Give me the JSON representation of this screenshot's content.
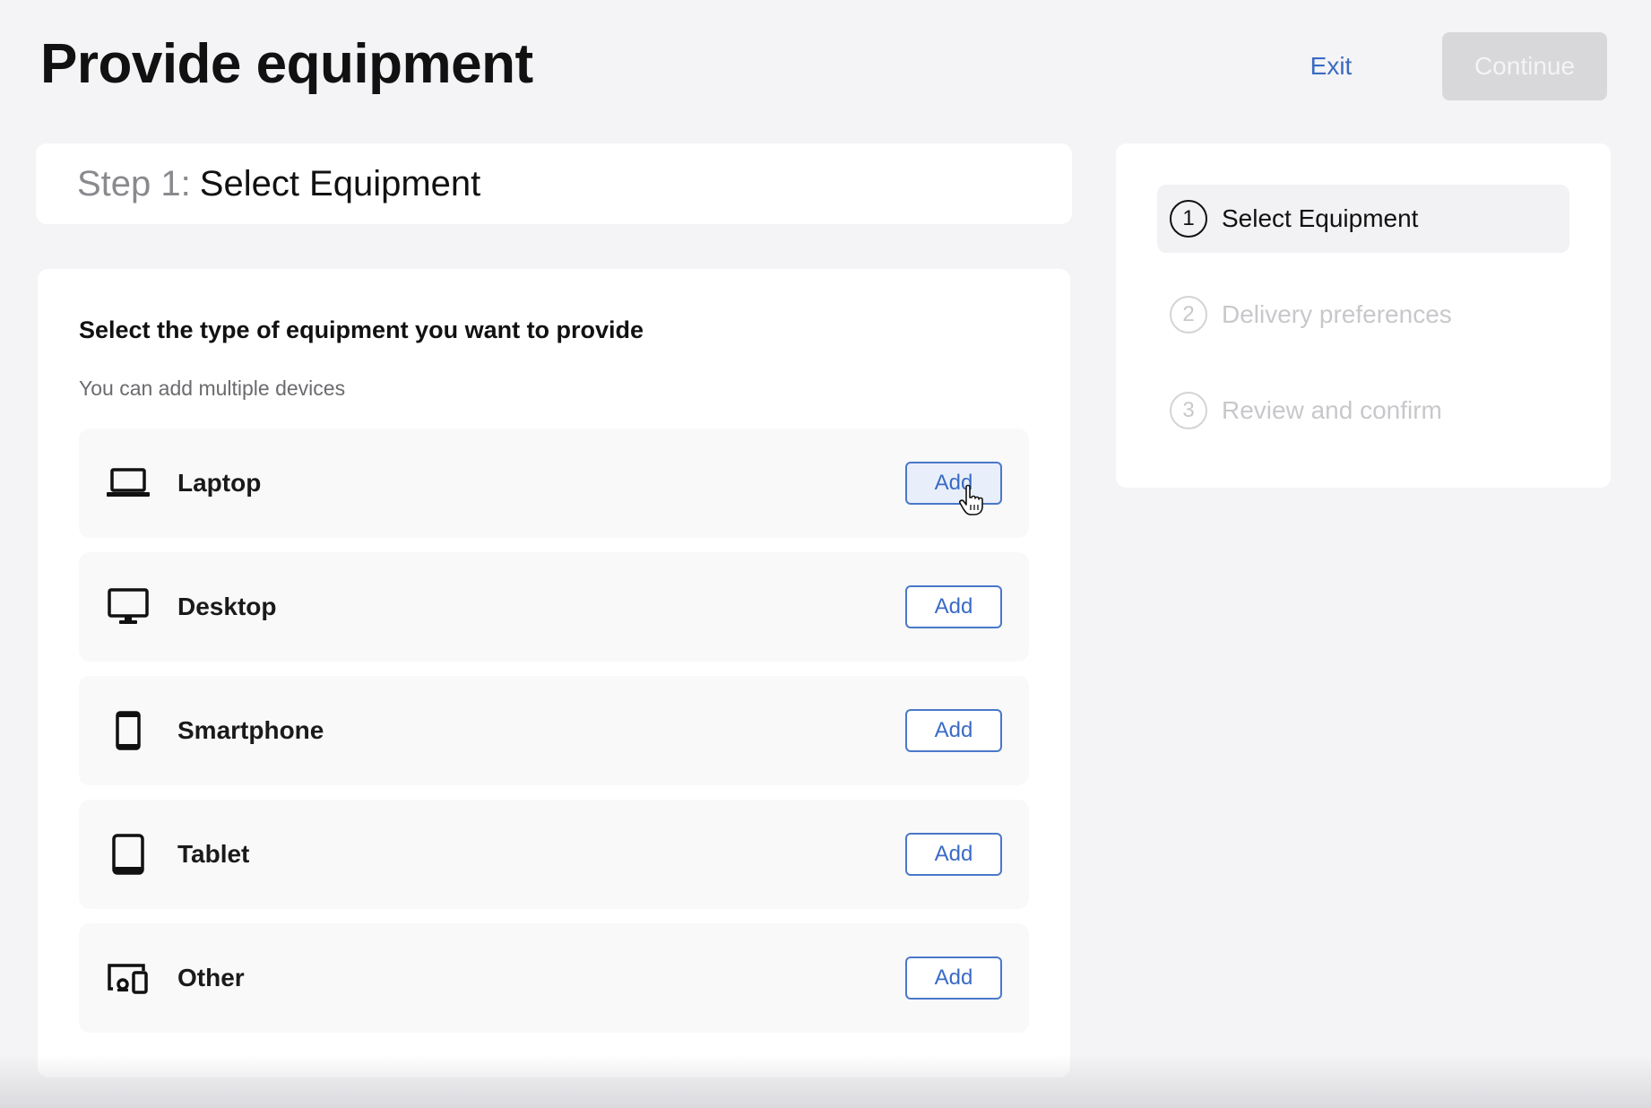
{
  "header": {
    "title": "Provide equipment",
    "exit_label": "Exit",
    "continue_label": "Continue"
  },
  "step_header": {
    "prefix": "Step 1:",
    "name": "Select Equipment"
  },
  "equipment": {
    "title": "Select the type of equipment you want to provide",
    "subtitle": "You can add multiple devices",
    "add_label": "Add",
    "devices": [
      {
        "label": "Laptop",
        "icon": "laptop-icon"
      },
      {
        "label": "Desktop",
        "icon": "desktop-icon"
      },
      {
        "label": "Smartphone",
        "icon": "smartphone-icon"
      },
      {
        "label": "Tablet",
        "icon": "tablet-icon"
      },
      {
        "label": "Other",
        "icon": "other-devices-icon"
      }
    ]
  },
  "stepper": {
    "steps": [
      {
        "number": "1",
        "label": "Select Equipment",
        "state": "active"
      },
      {
        "number": "2",
        "label": "Delivery preferences",
        "state": "inactive"
      },
      {
        "number": "3",
        "label": "Review and confirm",
        "state": "inactive"
      }
    ]
  },
  "colors": {
    "accent": "#3a6bc4",
    "background": "#f4f4f6",
    "disabled_button": "#d8d8da"
  }
}
